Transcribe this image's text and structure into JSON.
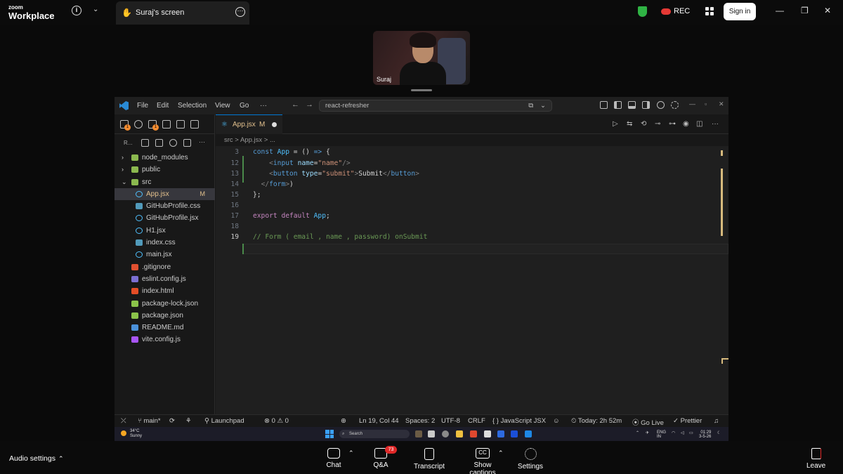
{
  "zoom": {
    "logo_line1": "zoom",
    "logo_line2": "Workplace",
    "share_tab_label": "Suraj's screen",
    "rec_label": "REC",
    "signin_label": "Sign in",
    "participant_name": "Suraj"
  },
  "vscode": {
    "menu": [
      "File",
      "Edit",
      "Selection",
      "View",
      "Go",
      "···"
    ],
    "command_center": "react-refresher",
    "explorer_label": "R...",
    "tab": {
      "name": "App.jsx",
      "status": "M"
    },
    "breadcrumb": "src  >  App.jsx  >  ...",
    "tree": [
      {
        "label": "node_modules",
        "type": "folder",
        "expanded": false,
        "status": ""
      },
      {
        "label": "public",
        "type": "folder",
        "expanded": false,
        "status": ""
      },
      {
        "label": "src",
        "type": "folder",
        "expanded": true,
        "status": ""
      },
      {
        "label": "App.jsx",
        "type": "jsx",
        "status": "M",
        "selected": true
      },
      {
        "label": "GitHubProfile.css",
        "type": "css",
        "status": ""
      },
      {
        "label": "GitHubProfile.jsx",
        "type": "jsx",
        "status": ""
      },
      {
        "label": "H1.jsx",
        "type": "jsx",
        "status": ""
      },
      {
        "label": "index.css",
        "type": "css",
        "status": ""
      },
      {
        "label": "main.jsx",
        "type": "jsx",
        "status": ""
      },
      {
        "label": ".gitignore",
        "type": "git",
        "status": ""
      },
      {
        "label": "eslint.config.js",
        "type": "eslint",
        "status": ""
      },
      {
        "label": "index.html",
        "type": "html",
        "status": ""
      },
      {
        "label": "package-lock.json",
        "type": "json",
        "status": ""
      },
      {
        "label": "package.json",
        "type": "json",
        "status": ""
      },
      {
        "label": "README.md",
        "type": "md",
        "status": ""
      },
      {
        "label": "vite.config.js",
        "type": "vite",
        "status": ""
      }
    ],
    "code_lines": [
      {
        "num": "3",
        "text": "const App = () => {"
      },
      {
        "num": "12",
        "text": "    <input name=\"name\"/>"
      },
      {
        "num": "13",
        "text": "    <button type=\"submit\">Submit</button>"
      },
      {
        "num": "14",
        "text": "  </form>)"
      },
      {
        "num": "15",
        "text": "};"
      },
      {
        "num": "16",
        "text": ""
      },
      {
        "num": "17",
        "text": "export default App;"
      },
      {
        "num": "18",
        "text": ""
      },
      {
        "num": "19",
        "text": "// Form ( email , name , password) onSubmit"
      }
    ],
    "status": {
      "branch": "main*",
      "launchpad": "Launchpad",
      "problems": "⊗ 0 ⚠ 0",
      "position": "Ln 19, Col 44",
      "spaces": "Spaces: 2",
      "encoding": "UTF-8",
      "eol": "CRLF",
      "language": "{ } JavaScript JSX",
      "time": "Today: 2h 52m",
      "golive": "Go Live",
      "prettier": "Prettier"
    }
  },
  "taskbar": {
    "temp": "34°C",
    "weather": "Sunny",
    "search": "Search",
    "lang1": "ENG",
    "lang2": "IN",
    "clock_time": "01:29",
    "clock_date": "3-5-26"
  },
  "bottom": {
    "audio_label": "Audio settings",
    "chat": "Chat",
    "qa": "Q&A",
    "qa_count": "73",
    "transcript": "Transcript",
    "captions": "Show captions",
    "settings": "Settings",
    "leave": "Leave"
  },
  "colors": {
    "vscode_accent": "#0078d4",
    "modified": "#e2c08d",
    "leave_red": "#e02828",
    "secure_green": "#2fb344"
  }
}
